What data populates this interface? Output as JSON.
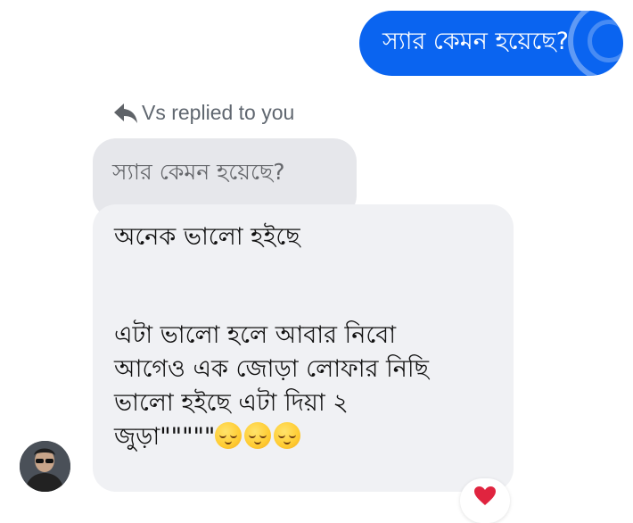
{
  "outgoing": {
    "text": "স্যার কেমন হয়েছে?"
  },
  "reply_header": {
    "icon": "reply-arrow-icon",
    "text": "Vs replied to you"
  },
  "quoted": {
    "text": "স্যার কেমন হয়েছে?"
  },
  "received": {
    "lines": [
      "অনেক ভালো  হইছে",
      "এটা ভালো হলে আবার নিবো",
      "আগেও এক জোড়া লোফার  নিছি",
      "ভালো হইছে  এটা দিয়া ২",
      "জুড়া\"\"\"\"\""
    ],
    "emojis": [
      "relieved-face-emoji",
      "relieved-face-emoji",
      "relieved-face-emoji"
    ]
  },
  "reaction": {
    "icon": "red-heart-icon"
  },
  "colors": {
    "outgoing_bubble": "#0a64f0",
    "received_bubble": "#f0f1f4",
    "quoted_bubble": "#e6e7eb",
    "meta_text": "#606770",
    "heart": "#e0243f"
  }
}
